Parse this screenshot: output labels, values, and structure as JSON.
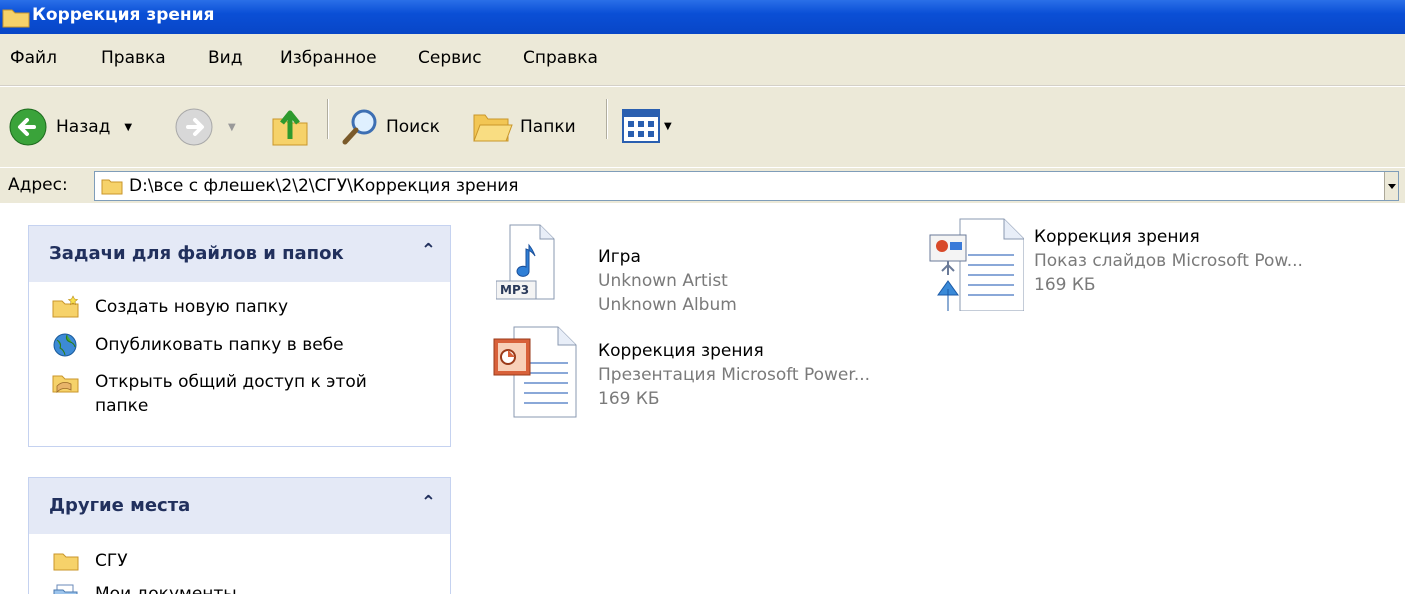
{
  "window": {
    "title": "Коррекция зрения"
  },
  "menu": [
    "Файл",
    "Правка",
    "Вид",
    "Избранное",
    "Сервис",
    "Справка"
  ],
  "toolbar": {
    "back": "Назад",
    "search": "Поиск",
    "folders": "Папки"
  },
  "address": {
    "label": "Адрес:",
    "path": "D:\\все с флешек\\2\\2\\СГУ\\Коррекция зрения"
  },
  "tasks": {
    "title": "Задачи для файлов и папок",
    "items": [
      "Создать новую папку",
      "Опубликовать папку в вебе",
      "Открыть общий доступ к этой",
      "папке"
    ]
  },
  "places": {
    "title": "Другие места",
    "items": [
      "СГУ",
      "Мои документы"
    ]
  },
  "files": [
    {
      "name": "Игра",
      "line1": "Unknown Artist",
      "line2": "Unknown Album",
      "icon": "mp3-icon",
      "badge": "MP3"
    },
    {
      "name": "Коррекция зрения",
      "line1": "Показ слайдов Microsoft Pow...",
      "line2": "169 КБ",
      "icon": "pps-icon"
    },
    {
      "name": "Коррекция зрения",
      "line1": "Презентация Microsoft Power...",
      "line2": "169 КБ",
      "icon": "ppt-icon"
    }
  ]
}
